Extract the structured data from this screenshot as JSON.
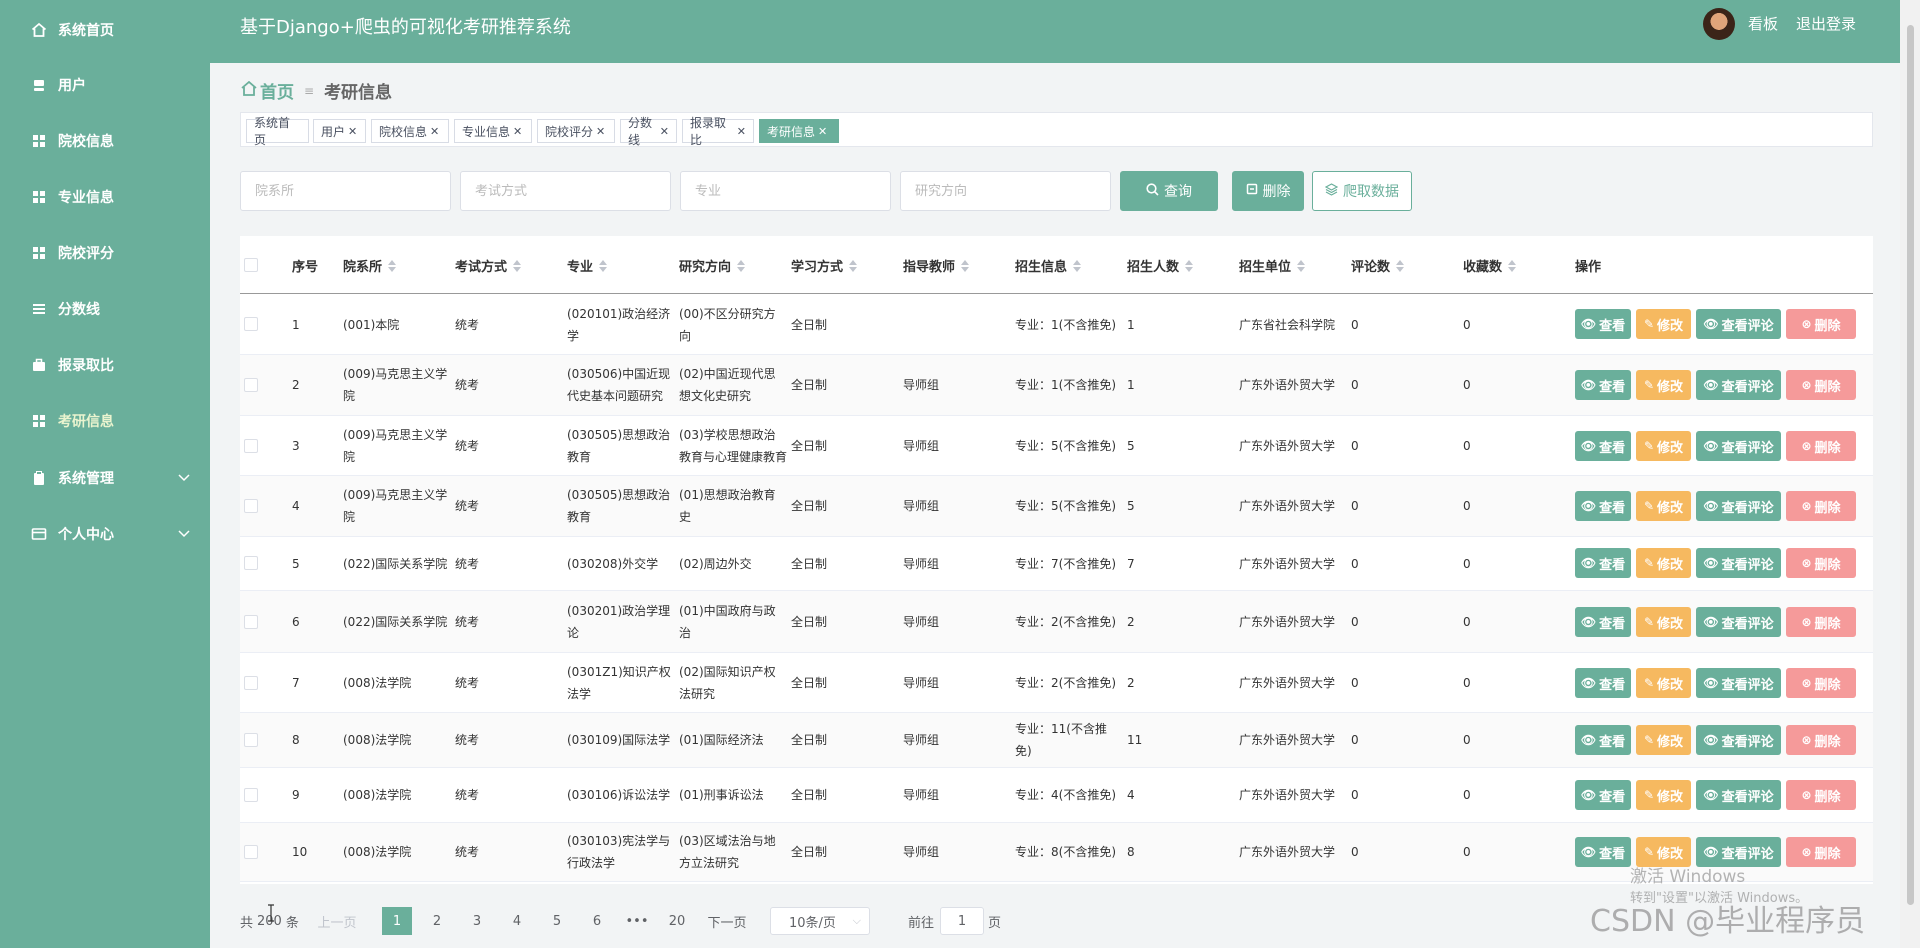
{
  "sidebar": {
    "items": [
      {
        "label": "系统首页",
        "icon": "home-icon"
      },
      {
        "label": "用户",
        "icon": "user-icon"
      },
      {
        "label": "院校信息",
        "icon": "grid-icon"
      },
      {
        "label": "专业信息",
        "icon": "grid-icon"
      },
      {
        "label": "院校评分",
        "icon": "grid-icon"
      },
      {
        "label": "分数线",
        "icon": "list-icon"
      },
      {
        "label": "报录取比",
        "icon": "briefcase-icon"
      },
      {
        "label": "考研信息",
        "icon": "grid-icon"
      },
      {
        "label": "系统管理",
        "icon": "clipboard-icon"
      },
      {
        "label": "个人中心",
        "icon": "card-icon"
      }
    ]
  },
  "header": {
    "title": "基于Django+爬虫的可视化考研推荐系统",
    "dashboard_label": "看板",
    "logout_label": "退出登录"
  },
  "breadcrumb": {
    "home": "首页",
    "current": "考研信息"
  },
  "tags": [
    "系统首页",
    "用户",
    "院校信息",
    "专业信息",
    "院校评分",
    "分数线",
    "报录取比",
    "考研信息"
  ],
  "search": {
    "dept_placeholder": "院系所",
    "exam_placeholder": "考试方式",
    "major_placeholder": "专业",
    "direction_placeholder": "研究方向",
    "query_label": "查询",
    "delete_label": "删除",
    "crawl_label": "爬取数据"
  },
  "table": {
    "headers": [
      "序号",
      "院系所",
      "考试方式",
      "专业",
      "研究方向",
      "学习方式",
      "指导教师",
      "招生信息",
      "招生人数",
      "招生单位",
      "评论数",
      "收藏数",
      "操作"
    ],
    "actions": {
      "view": "查看",
      "edit": "修改",
      "comments": "查看评论",
      "delete": "删除"
    },
    "rows": [
      [
        "1",
        "(001)本院",
        "统考",
        "(020101)政治经济学",
        "(00)不区分研究方向",
        "全日制",
        "",
        "专业：1(不含推免)",
        "1",
        "广东省社会科学院",
        "0",
        "0"
      ],
      [
        "2",
        "(009)马克思主义学院",
        "统考",
        "(030506)中国近现代史基本问题研究",
        "(02)中国近现代思想文化史研究",
        "全日制",
        "导师组",
        "专业：1(不含推免)",
        "1",
        "广东外语外贸大学",
        "0",
        "0"
      ],
      [
        "3",
        "(009)马克思主义学院",
        "统考",
        "(030505)思想政治教育",
        "(03)学校思想政治教育与心理健康教育",
        "全日制",
        "导师组",
        "专业：5(不含推免)",
        "5",
        "广东外语外贸大学",
        "0",
        "0"
      ],
      [
        "4",
        "(009)马克思主义学院",
        "统考",
        "(030505)思想政治教育",
        "(01)思想政治教育史",
        "全日制",
        "导师组",
        "专业：5(不含推免)",
        "5",
        "广东外语外贸大学",
        "0",
        "0"
      ],
      [
        "5",
        "(022)国际关系学院",
        "统考",
        "(030208)外交学",
        "(02)周边外交",
        "全日制",
        "导师组",
        "专业：7(不含推免)",
        "7",
        "广东外语外贸大学",
        "0",
        "0"
      ],
      [
        "6",
        "(022)国际关系学院",
        "统考",
        "(030201)政治学理论",
        "(01)中国政府与政治",
        "全日制",
        "导师组",
        "专业：2(不含推免)",
        "2",
        "广东外语外贸大学",
        "0",
        "0"
      ],
      [
        "7",
        "(008)法学院",
        "统考",
        "(0301Z1)知识产权法学",
        "(02)国际知识产权法研究",
        "全日制",
        "导师组",
        "专业：2(不含推免)",
        "2",
        "广东外语外贸大学",
        "0",
        "0"
      ],
      [
        "8",
        "(008)法学院",
        "统考",
        "(030109)国际法学",
        "(01)国际经济法",
        "全日制",
        "导师组",
        "专业：11(不含推免)",
        "11",
        "广东外语外贸大学",
        "0",
        "0"
      ],
      [
        "9",
        "(008)法学院",
        "统考",
        "(030106)诉讼法学",
        "(01)刑事诉讼法",
        "全日制",
        "导师组",
        "专业：4(不含推免)",
        "4",
        "广东外语外贸大学",
        "0",
        "0"
      ],
      [
        "10",
        "(008)法学院",
        "统考",
        "(030103)宪法学与行政法学",
        "(03)区域法治与地方立法研究",
        "全日制",
        "导师组",
        "专业：8(不含推免)",
        "8",
        "广东外语外贸大学",
        "0",
        "0"
      ]
    ]
  },
  "pagination": {
    "total_prefix": "共",
    "total": "200",
    "total_suffix": "条",
    "prev": "上一页",
    "pages": [
      "1",
      "2",
      "3",
      "4",
      "5",
      "6",
      "•••",
      "20"
    ],
    "next": "下一页",
    "page_size": "10条/页",
    "goto_label": "前往",
    "goto_value": "1",
    "goto_suffix": "页"
  },
  "watermark": {
    "line1": "激活 Windows",
    "line2": "转到\"设置\"以激活 Windows。",
    "csdn": "CSDN @毕业程序员"
  }
}
